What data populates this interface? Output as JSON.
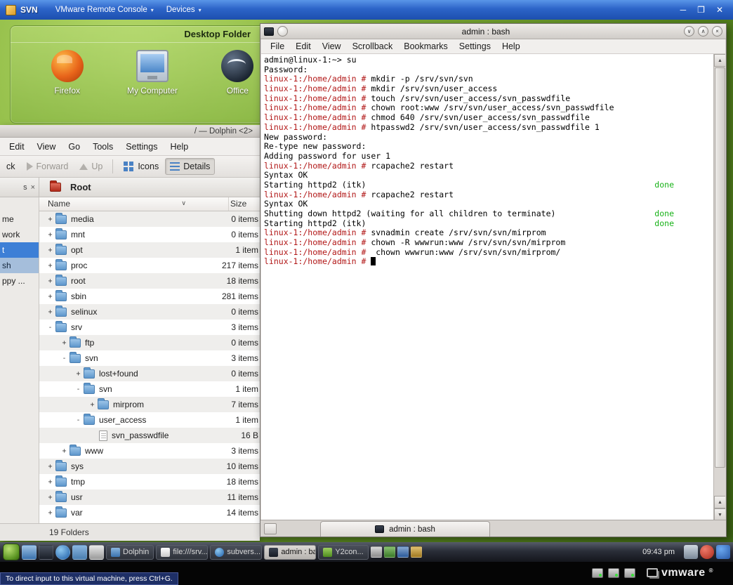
{
  "vmware": {
    "window_title": "SVN",
    "menus": [
      {
        "label": "VMware Remote Console"
      },
      {
        "label": "Devices"
      }
    ],
    "controls": {
      "minimize": "─",
      "maximize": "❐",
      "close": "✕"
    },
    "status_hint": "To direct input to this virtual machine, press Ctrl+G.",
    "brand": "vmware",
    "brand_reg": "®"
  },
  "desktop_widget": {
    "title": "Desktop Folder",
    "icons": [
      {
        "label": "Firefox",
        "icon": "firefox-icon"
      },
      {
        "label": "My Computer",
        "icon": "computer-icon"
      },
      {
        "label": "Office",
        "icon": "office-icon"
      }
    ]
  },
  "dolphin": {
    "title": "/ — Dolphin <2>",
    "menu": [
      "Edit",
      "View",
      "Go",
      "Tools",
      "Settings",
      "Help"
    ],
    "toolbar": {
      "back": "ck",
      "forward": "Forward",
      "up": "Up",
      "icons": "Icons",
      "details": "Details"
    },
    "places_header": "s",
    "places_close": "×",
    "places": [
      {
        "label": "me",
        "state": "none"
      },
      {
        "label": "work",
        "state": "none"
      },
      {
        "label": "t",
        "state": "selected"
      },
      {
        "label": "sh",
        "state": "alt"
      },
      {
        "label": "ppy ...",
        "state": "none"
      }
    ],
    "view_header": "Root",
    "columns": {
      "name": "Name",
      "size": "Size",
      "sort_arrow": "∨"
    },
    "rows": [
      {
        "depth": 1,
        "exp": "+",
        "icon": "folder",
        "name": "media",
        "size": "0 items",
        "shade": true
      },
      {
        "depth": 1,
        "exp": "+",
        "icon": "folder",
        "name": "mnt",
        "size": "0 items",
        "shade": false
      },
      {
        "depth": 1,
        "exp": "+",
        "icon": "folder",
        "name": "opt",
        "size": "1 item",
        "shade": true
      },
      {
        "depth": 1,
        "exp": "+",
        "icon": "folder",
        "name": "proc",
        "size": "217 items",
        "shade": false
      },
      {
        "depth": 1,
        "exp": "+",
        "icon": "folder",
        "name": "root",
        "size": "18 items",
        "shade": true
      },
      {
        "depth": 1,
        "exp": "+",
        "icon": "folder",
        "name": "sbin",
        "size": "281 items",
        "shade": false
      },
      {
        "depth": 1,
        "exp": "+",
        "icon": "folder",
        "name": "selinux",
        "size": "0 items",
        "shade": true
      },
      {
        "depth": 1,
        "exp": "-",
        "icon": "folder",
        "name": "srv",
        "size": "3 items",
        "shade": false
      },
      {
        "depth": 2,
        "exp": "+",
        "icon": "folder",
        "name": "ftp",
        "size": "0 items",
        "shade": true
      },
      {
        "depth": 2,
        "exp": "-",
        "icon": "folder",
        "name": "svn",
        "size": "3 items",
        "shade": false
      },
      {
        "depth": 3,
        "exp": "+",
        "icon": "folder",
        "name": "lost+found",
        "size": "0 items",
        "shade": true
      },
      {
        "depth": 3,
        "exp": "-",
        "icon": "folder",
        "name": "svn",
        "size": "1 item",
        "shade": false
      },
      {
        "depth": 4,
        "exp": "+",
        "icon": "folder",
        "name": "mirprom",
        "size": "7 items",
        "shade": true
      },
      {
        "depth": 3,
        "exp": "-",
        "icon": "folder",
        "name": "user_access",
        "size": "1 item",
        "shade": false
      },
      {
        "depth": 4,
        "exp": "",
        "icon": "file",
        "name": "svn_passwdfile",
        "size": "16 B",
        "shade": true
      },
      {
        "depth": 2,
        "exp": "+",
        "icon": "folder",
        "name": "www",
        "size": "3 items",
        "shade": false
      },
      {
        "depth": 1,
        "exp": "+",
        "icon": "folder",
        "name": "sys",
        "size": "10 items",
        "shade": true
      },
      {
        "depth": 1,
        "exp": "+",
        "icon": "folder",
        "name": "tmp",
        "size": "18 items",
        "shade": false
      },
      {
        "depth": 1,
        "exp": "+",
        "icon": "folder",
        "name": "usr",
        "size": "11 items",
        "shade": true
      },
      {
        "depth": 1,
        "exp": "+",
        "icon": "folder",
        "name": "var",
        "size": "14 items",
        "shade": false
      }
    ],
    "status": "19 Folders"
  },
  "konsole": {
    "title": "admin : bash",
    "menu": [
      "File",
      "Edit",
      "View",
      "Scrollback",
      "Bookmarks",
      "Settings",
      "Help"
    ],
    "controls": {
      "shade": "∨",
      "max": "∧",
      "close": "×"
    },
    "tab_label": "admin : bash",
    "colors": {
      "prompt": "#b21818",
      "done": "#18b218"
    },
    "lines": [
      {
        "prompt": "",
        "text": "admin@linux-1:~> su",
        "done": ""
      },
      {
        "prompt": "",
        "text": "Password:",
        "done": ""
      },
      {
        "prompt": "linux-1:/home/admin #",
        "text": " mkdir -p /srv/svn/svn",
        "done": ""
      },
      {
        "prompt": "linux-1:/home/admin #",
        "text": " mkdir /srv/svn/user_access",
        "done": ""
      },
      {
        "prompt": "linux-1:/home/admin #",
        "text": " touch /srv/svn/user_access/svn_passwdfile",
        "done": ""
      },
      {
        "prompt": "linux-1:/home/admin #",
        "text": " chown root:www /srv/svn/user_access/svn_passwdfile",
        "done": ""
      },
      {
        "prompt": "linux-1:/home/admin #",
        "text": " chmod 640 /srv/svn/user_access/svn_passwdfile",
        "done": ""
      },
      {
        "prompt": "linux-1:/home/admin #",
        "text": " htpasswd2 /srv/svn/user_access/svn_passwdfile 1",
        "done": ""
      },
      {
        "prompt": "",
        "text": "New password:",
        "done": ""
      },
      {
        "prompt": "",
        "text": "Re-type new password:",
        "done": ""
      },
      {
        "prompt": "",
        "text": "Adding password for user 1",
        "done": ""
      },
      {
        "prompt": "linux-1:/home/admin #",
        "text": " rcapache2 restart",
        "done": ""
      },
      {
        "prompt": "",
        "text": "Syntax OK",
        "done": ""
      },
      {
        "prompt": "",
        "text": "Starting httpd2 (itk)",
        "done": "done"
      },
      {
        "prompt": "linux-1:/home/admin #",
        "text": " rcapache2 restart",
        "done": ""
      },
      {
        "prompt": "",
        "text": "Syntax OK",
        "done": ""
      },
      {
        "prompt": "",
        "text": "Shutting down httpd2 (waiting for all children to terminate)",
        "done": "done"
      },
      {
        "prompt": "",
        "text": "Starting httpd2 (itk)",
        "done": "done"
      },
      {
        "prompt": "linux-1:/home/admin #",
        "text": " svnadmin create /srv/svn/svn/mirprom",
        "done": ""
      },
      {
        "prompt": "linux-1:/home/admin #",
        "text": " chown -R wwwrun:www /srv/svn/svn/mirprom",
        "done": ""
      },
      {
        "prompt": "linux-1:/home/admin #",
        "text": "  chown wwwrun:www /srv/svn/svn/mirprom/",
        "done": ""
      }
    ],
    "cursor_prompt": "linux-1:/home/admin # "
  },
  "taskbar": {
    "launchers": [
      {
        "name": "desktop-icon"
      },
      {
        "name": "terminal-launcher-icon"
      },
      {
        "name": "browser-icon"
      },
      {
        "name": "folder-launcher-icon"
      },
      {
        "name": "office-launcher-icon"
      }
    ],
    "tasks": [
      {
        "label": "Dolphin",
        "icon": "dolphin-task-icon",
        "active": "false"
      },
      {
        "label": "file:///srv...",
        "icon": "file-task-icon",
        "active": "false"
      },
      {
        "label": "subvers...",
        "icon": "globe-task-icon",
        "active": "false"
      },
      {
        "label": "admin : ba...",
        "icon": "terminal-task-icon",
        "active": "true"
      },
      {
        "label": "Y2con...",
        "icon": "yast-task-icon",
        "active": "false"
      }
    ],
    "tray": [
      {
        "name": "clipboard-tray-icon"
      },
      {
        "name": "volume-tray-icon"
      },
      {
        "name": "network-tray-icon"
      },
      {
        "name": "klipper-tray-icon"
      }
    ],
    "clock": "09:43 pm",
    "right_icons": [
      {
        "name": "display-icon"
      },
      {
        "name": "security-icon"
      },
      {
        "name": "updates-icon"
      }
    ]
  },
  "vm_status_icons": [
    {
      "name": "hdd-status-icon"
    },
    {
      "name": "network-status-icon"
    },
    {
      "name": "usb-status-icon"
    }
  ]
}
